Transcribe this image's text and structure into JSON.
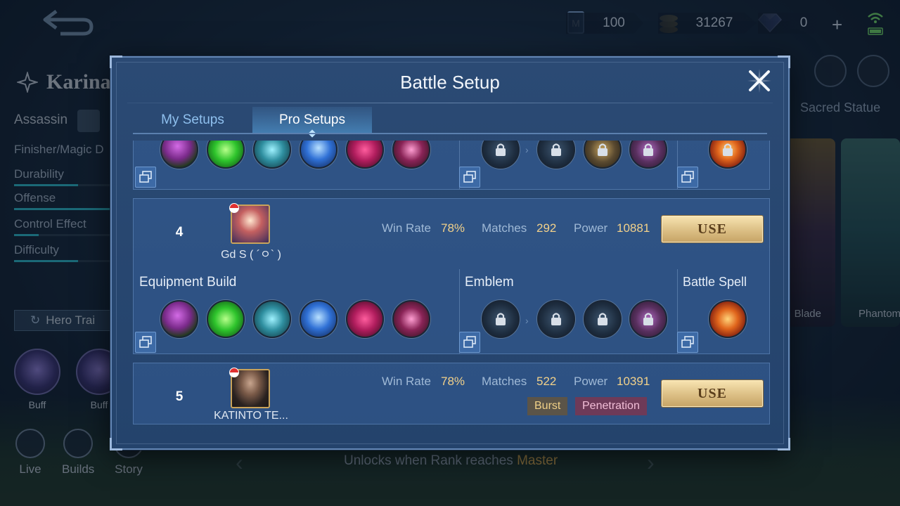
{
  "topbar": {
    "ticket_value": "100",
    "bp_value": "31267",
    "diamond_value": "0",
    "add_label": "+"
  },
  "hero": {
    "name": "Karina",
    "role": "Assassin",
    "specialty": "Finisher/Magic D",
    "stats": [
      {
        "label": "Durability",
        "level": 0.65
      },
      {
        "label": "Offense",
        "level": 1.0
      },
      {
        "label": "Control Effect",
        "level": 0.25
      },
      {
        "label": "Difficulty",
        "level": 0.65
      }
    ],
    "train_label": "Hero Trai",
    "buffs": [
      {
        "label": "Buff"
      },
      {
        "label": "Buff"
      }
    ],
    "nav": [
      {
        "label": "Live"
      },
      {
        "label": "Builds"
      },
      {
        "label": "Story"
      }
    ]
  },
  "right_panel": {
    "sacred_statue": "Sacred Statue",
    "skin_labels": [
      "Blade",
      "Phantom"
    ]
  },
  "footer": {
    "unlock_text": "Unlocks when Rank reaches ",
    "unlock_rank": "Master"
  },
  "dialog": {
    "title": "Battle Setup",
    "tabs": [
      {
        "label": "My Setups",
        "active": false
      },
      {
        "label": "Pro Setups",
        "active": true
      }
    ],
    "section_titles": {
      "equipment": "Equipment Build",
      "emblem": "Emblem",
      "spell": "Battle Spell"
    },
    "setups": [
      {
        "rank": "4",
        "player": "Gd S ( ´ㅇ` )",
        "win_rate_label": "Win Rate",
        "win_rate": "78%",
        "matches_label": "Matches",
        "matches": "292",
        "power_label": "Power",
        "power": "10881",
        "use_label": "USE",
        "items": [
          "magic-shoes",
          "clock-of-destiny",
          "lightning-truncheon",
          "holy-crystal",
          "blood-wings",
          "divine-glaive"
        ],
        "emblems": [
          "emblem-main",
          "emblem-talent-1",
          "emblem-talent-2",
          "emblem-talent-3"
        ],
        "spell": "execute"
      },
      {
        "rank": "5",
        "player": "KATINTO TE...",
        "win_rate_label": "Win Rate",
        "win_rate": "78%",
        "matches_label": "Matches",
        "matches": "522",
        "power_label": "Power",
        "power": "10391",
        "use_label": "USE",
        "tags": [
          "Burst",
          "Penetration"
        ]
      }
    ]
  },
  "colors": {
    "accent_gold": "#f2d18a",
    "tab_active": "#ffffff",
    "tab_inactive": "#8fc0ee",
    "use_button": "#dcbf85"
  }
}
